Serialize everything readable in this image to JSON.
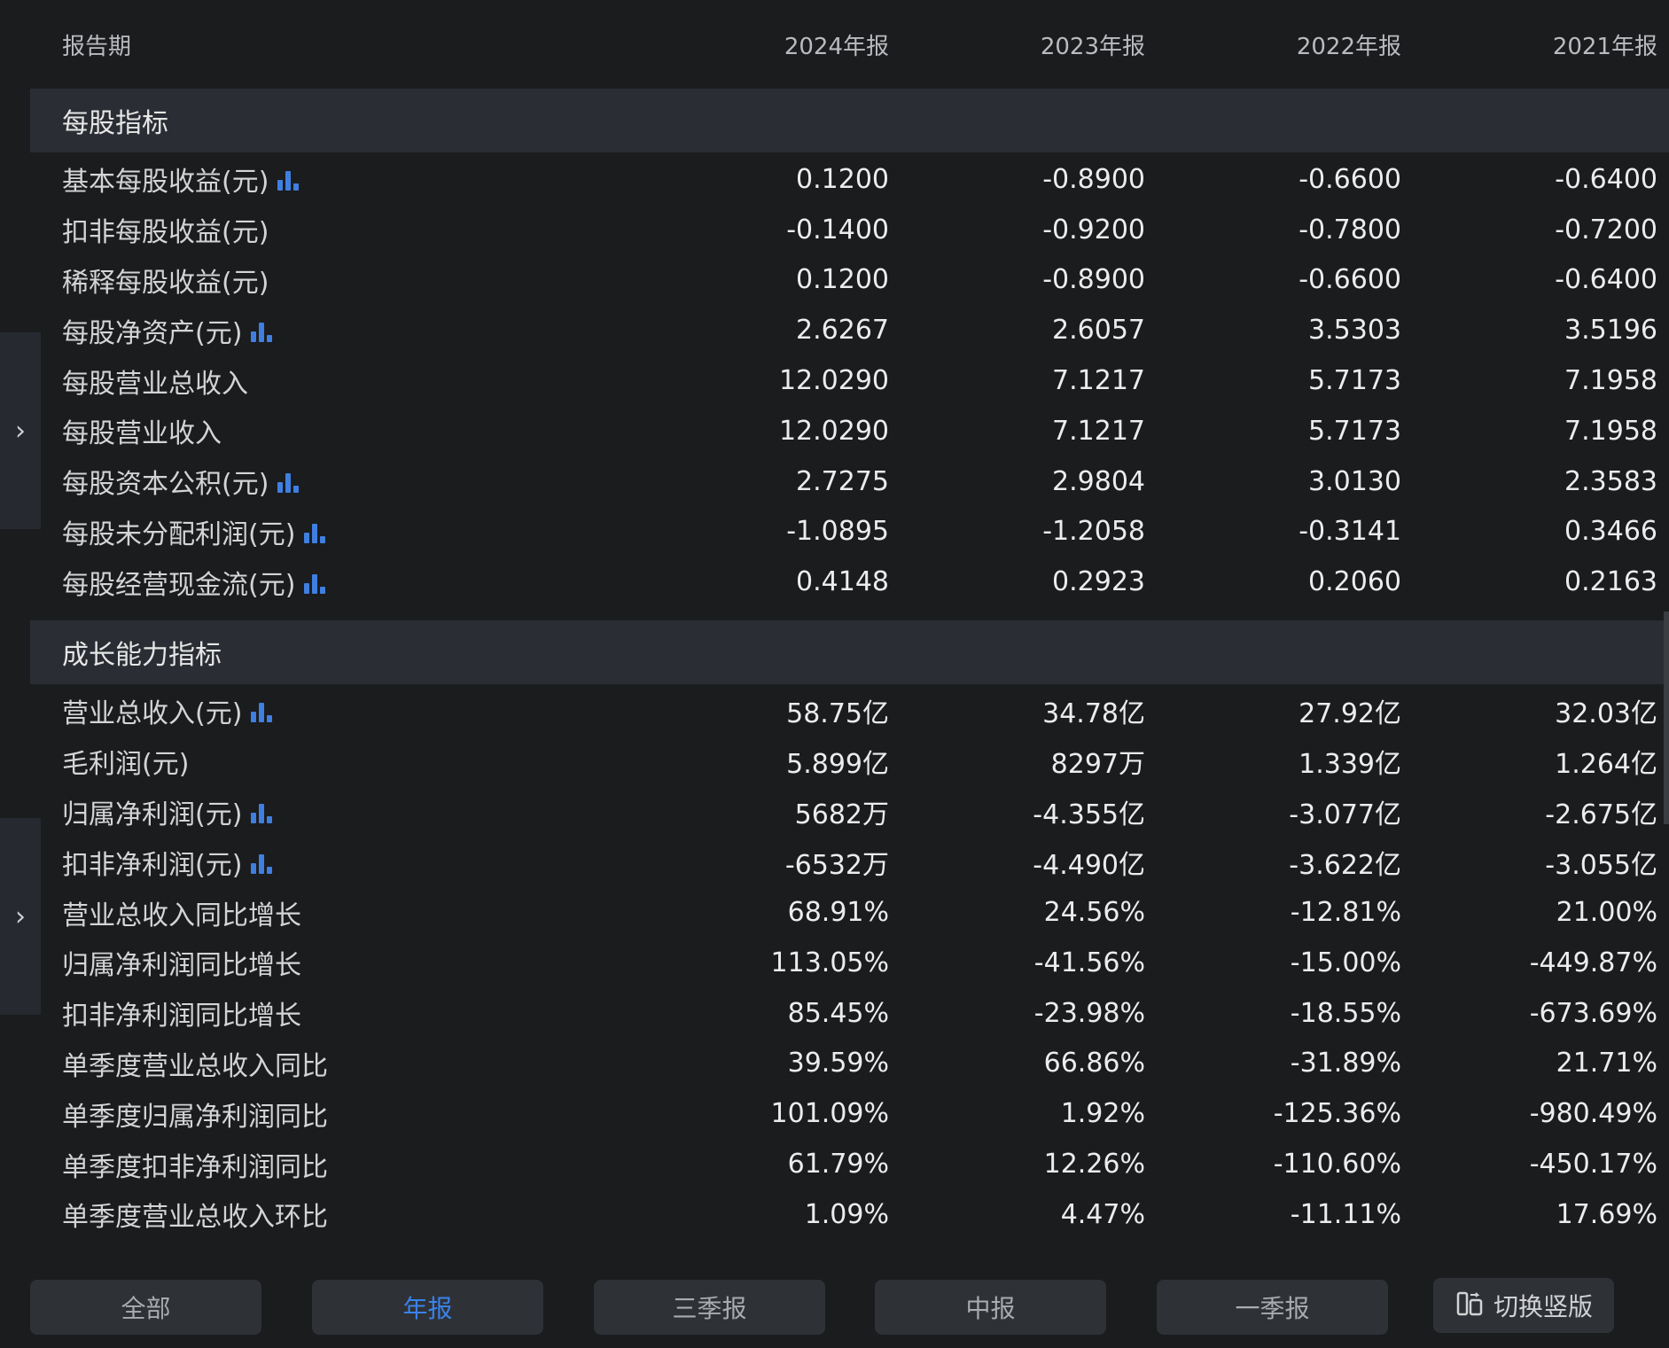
{
  "header": {
    "label": "报告期",
    "periods": [
      "2024年报",
      "2023年报",
      "2022年报",
      "2021年报"
    ]
  },
  "sections": [
    {
      "title": "每股指标",
      "rows": [
        {
          "label": "基本每股收益(元)",
          "chart": true,
          "values": [
            "0.1200",
            "-0.8900",
            "-0.6600",
            "-0.6400"
          ]
        },
        {
          "label": "扣非每股收益(元)",
          "chart": false,
          "values": [
            "-0.1400",
            "-0.9200",
            "-0.7800",
            "-0.7200"
          ]
        },
        {
          "label": "稀释每股收益(元)",
          "chart": false,
          "values": [
            "0.1200",
            "-0.8900",
            "-0.6600",
            "-0.6400"
          ]
        },
        {
          "label": "每股净资产(元)",
          "chart": true,
          "values": [
            "2.6267",
            "2.6057",
            "3.5303",
            "3.5196"
          ]
        },
        {
          "label": "每股营业总收入",
          "chart": false,
          "values": [
            "12.0290",
            "7.1217",
            "5.7173",
            "7.1958"
          ]
        },
        {
          "label": "每股营业收入",
          "chart": false,
          "values": [
            "12.0290",
            "7.1217",
            "5.7173",
            "7.1958"
          ]
        },
        {
          "label": "每股资本公积(元)",
          "chart": true,
          "values": [
            "2.7275",
            "2.9804",
            "3.0130",
            "2.3583"
          ]
        },
        {
          "label": "每股未分配利润(元)",
          "chart": true,
          "values": [
            "-1.0895",
            "-1.2058",
            "-0.3141",
            "0.3466"
          ]
        },
        {
          "label": "每股经营现金流(元)",
          "chart": true,
          "values": [
            "0.4148",
            "0.2923",
            "0.2060",
            "0.2163"
          ]
        }
      ]
    },
    {
      "title": "成长能力指标",
      "rows": [
        {
          "label": "营业总收入(元)",
          "chart": true,
          "values": [
            "58.75亿",
            "34.78亿",
            "27.92亿",
            "32.03亿"
          ]
        },
        {
          "label": "毛利润(元)",
          "chart": false,
          "values": [
            "5.899亿",
            "8297万",
            "1.339亿",
            "1.264亿"
          ]
        },
        {
          "label": "归属净利润(元)",
          "chart": true,
          "values": [
            "5682万",
            "-4.355亿",
            "-3.077亿",
            "-2.675亿"
          ]
        },
        {
          "label": "扣非净利润(元)",
          "chart": true,
          "values": [
            "-6532万",
            "-4.490亿",
            "-3.622亿",
            "-3.055亿"
          ]
        },
        {
          "label": "营业总收入同比增长",
          "chart": false,
          "values": [
            "68.91%",
            "24.56%",
            "-12.81%",
            "21.00%"
          ]
        },
        {
          "label": "归属净利润同比增长",
          "chart": false,
          "values": [
            "113.05%",
            "-41.56%",
            "-15.00%",
            "-449.87%"
          ]
        },
        {
          "label": "扣非净利润同比增长",
          "chart": false,
          "values": [
            "85.45%",
            "-23.98%",
            "-18.55%",
            "-673.69%"
          ]
        },
        {
          "label": "单季度营业总收入同比",
          "chart": false,
          "values": [
            "39.59%",
            "66.86%",
            "-31.89%",
            "21.71%"
          ]
        },
        {
          "label": "单季度归属净利润同比",
          "chart": false,
          "values": [
            "101.09%",
            "1.92%",
            "-125.36%",
            "-980.49%"
          ]
        },
        {
          "label": "单季度扣非净利润同比",
          "chart": false,
          "values": [
            "61.79%",
            "12.26%",
            "-110.60%",
            "-450.17%"
          ]
        },
        {
          "label": "单季度营业总收入环比",
          "chart": false,
          "values": [
            "1.09%",
            "4.47%",
            "-11.11%",
            "17.69%"
          ]
        }
      ]
    }
  ],
  "tabs": [
    {
      "label": "全部",
      "active": false
    },
    {
      "label": "年报",
      "active": true
    },
    {
      "label": "三季报",
      "active": false
    },
    {
      "label": "中报",
      "active": false
    },
    {
      "label": "一季报",
      "active": false
    }
  ],
  "switch_button": {
    "label": "切换竖版",
    "icon": "layout-switch-icon"
  },
  "side_tabs": [
    {
      "icon": "chevron-right-icon",
      "glyph": "›"
    },
    {
      "icon": "chevron-right-icon",
      "glyph": "›"
    }
  ],
  "colors": {
    "background": "#1b1c1e",
    "section_bar": "#2a2d33",
    "accent": "#3b82e8",
    "chart_icon": "#3f7fe0"
  }
}
